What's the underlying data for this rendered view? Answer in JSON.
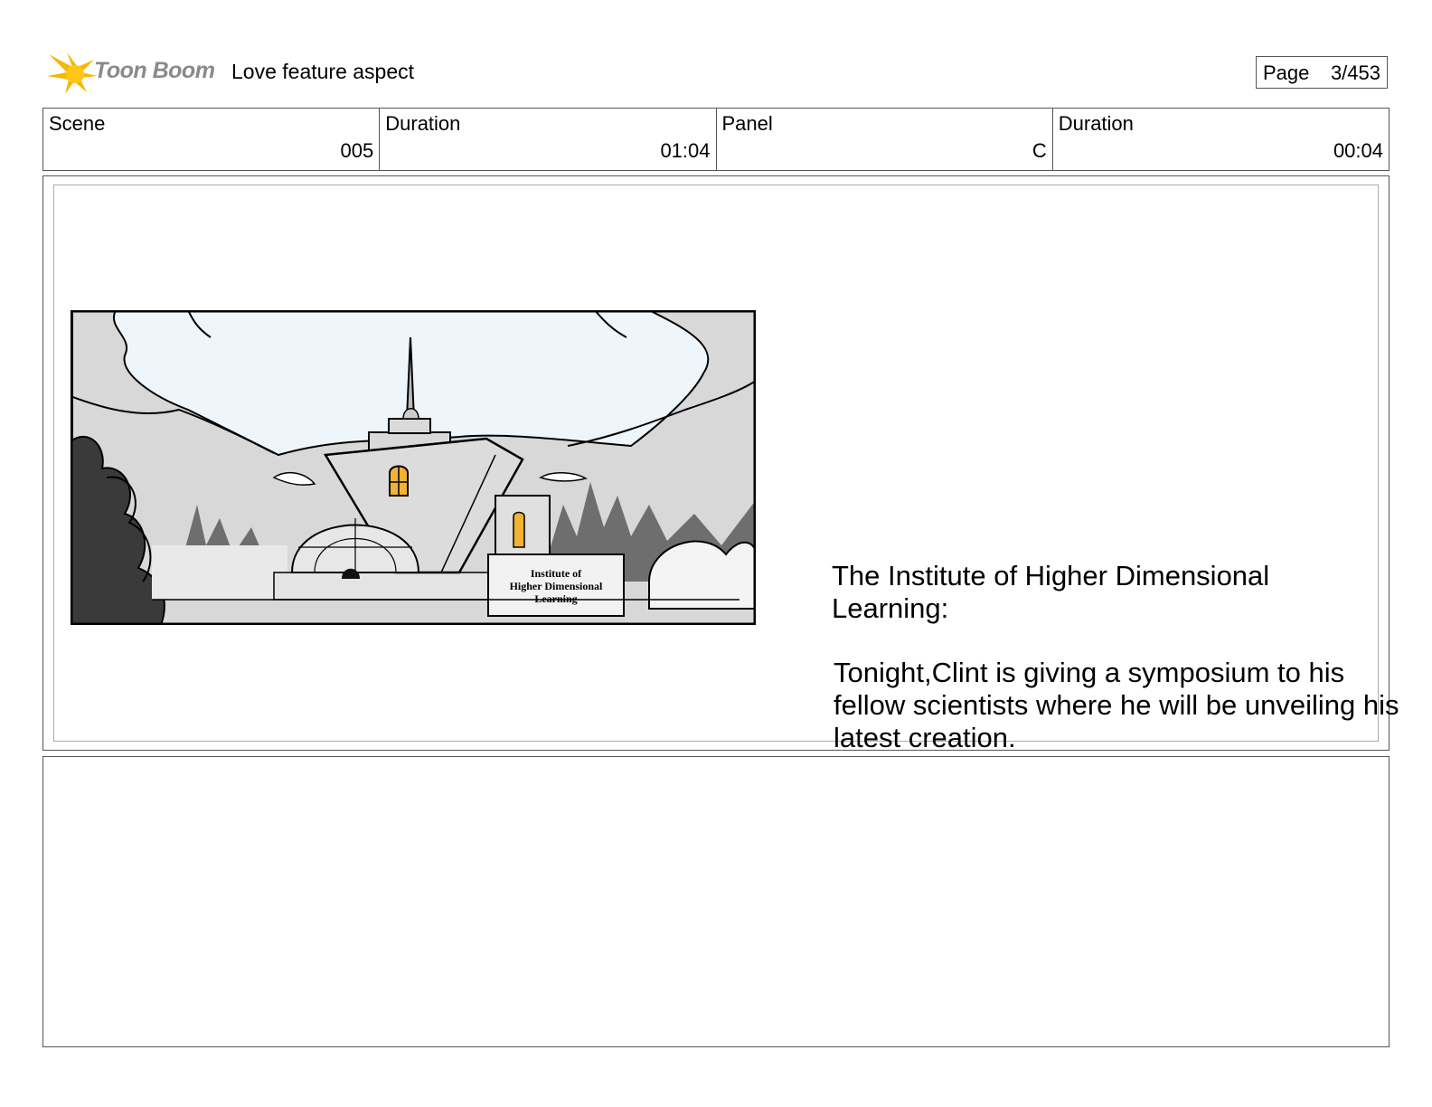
{
  "header": {
    "logo_text": "Toon Boom",
    "project_title": "Love feature aspect",
    "page_label": "Page",
    "page_number": "3/453"
  },
  "info": {
    "scene_label": "Scene",
    "scene_value": "005",
    "scene_duration_label": "Duration",
    "scene_duration_value": "01:04",
    "panel_label": "Panel",
    "panel_value": "C",
    "panel_duration_label": "Duration",
    "panel_duration_value": "00:04"
  },
  "panel": {
    "sign_line1": "Institute of",
    "sign_line2": "Higher Dimensional",
    "sign_line3": "Learning",
    "caption_title": "The Institute of Higher Dimensional Learning:",
    "caption_body": "Tonight,Clint is giving a symposium to his fellow scientists where he will be unveiling his latest creation."
  },
  "colors": {
    "logo_star": "#f5b800",
    "logo_text": "#8a8a8a",
    "window_glow": "#f2b233",
    "sky": "#eef5fb",
    "building": "#d9d9d9"
  }
}
